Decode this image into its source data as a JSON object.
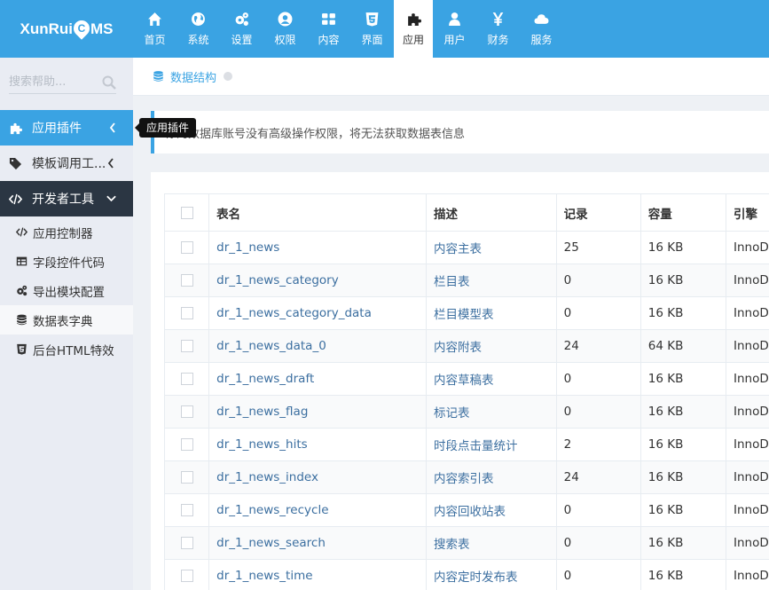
{
  "logo": {
    "pre": "XunRui",
    "drop": "C",
    "post": "MS"
  },
  "nav": [
    {
      "label": "首页",
      "icon": "home-icon"
    },
    {
      "label": "系统",
      "icon": "globe-icon"
    },
    {
      "label": "设置",
      "icon": "gears-icon"
    },
    {
      "label": "权限",
      "icon": "user-circle-icon"
    },
    {
      "label": "内容",
      "icon": "grid-icon"
    },
    {
      "label": "界面",
      "icon": "html5-icon"
    },
    {
      "label": "应用",
      "icon": "puzzle-icon"
    },
    {
      "label": "用户",
      "icon": "user-icon"
    },
    {
      "label": "财务",
      "icon": "yen-icon"
    },
    {
      "label": "服务",
      "icon": "cloud-icon"
    }
  ],
  "sidebar": {
    "search_placeholder": "搜索帮助...",
    "items": [
      {
        "label": "应用插件"
      },
      {
        "label": "模板调用工..."
      },
      {
        "label": "开发者工具"
      }
    ],
    "sub_items": [
      {
        "label": "应用控制器"
      },
      {
        "label": "字段控件代码"
      },
      {
        "label": "导出模块配置"
      },
      {
        "label": "数据表字典"
      },
      {
        "label": "后台HTML特效"
      }
    ]
  },
  "tooltip": "应用插件",
  "breadcrumb": {
    "label": "数据结构"
  },
  "note": "你的数据库账号没有高级操作权限，将无法获取数据表信息",
  "table": {
    "headers": [
      "表名",
      "描述",
      "记录",
      "容量",
      "引擎"
    ],
    "rows": [
      {
        "name": "dr_1_news",
        "desc": "内容主表",
        "records": "25",
        "size": "16 KB",
        "engine": "InnoDB"
      },
      {
        "name": "dr_1_news_category",
        "desc": "栏目表",
        "records": "0",
        "size": "16 KB",
        "engine": "InnoDB"
      },
      {
        "name": "dr_1_news_category_data",
        "desc": "栏目模型表",
        "records": "0",
        "size": "16 KB",
        "engine": "InnoDB"
      },
      {
        "name": "dr_1_news_data_0",
        "desc": "内容附表",
        "records": "24",
        "size": "64 KB",
        "engine": "InnoDB"
      },
      {
        "name": "dr_1_news_draft",
        "desc": "内容草稿表",
        "records": "0",
        "size": "16 KB",
        "engine": "InnoDB"
      },
      {
        "name": "dr_1_news_flag",
        "desc": "标记表",
        "records": "0",
        "size": "16 KB",
        "engine": "InnoDB"
      },
      {
        "name": "dr_1_news_hits",
        "desc": "时段点击量统计",
        "records": "2",
        "size": "16 KB",
        "engine": "InnoDB"
      },
      {
        "name": "dr_1_news_index",
        "desc": "内容索引表",
        "records": "24",
        "size": "16 KB",
        "engine": "InnoDB"
      },
      {
        "name": "dr_1_news_recycle",
        "desc": "内容回收站表",
        "records": "0",
        "size": "16 KB",
        "engine": "InnoDB"
      },
      {
        "name": "dr_1_news_search",
        "desc": "搜索表",
        "records": "0",
        "size": "16 KB",
        "engine": "InnoDB"
      },
      {
        "name": "dr_1_news_time",
        "desc": "内容定时发布表",
        "records": "0",
        "size": "16 KB",
        "engine": "InnoDB"
      }
    ]
  },
  "colors": {
    "accent": "#3aa3e3",
    "dark": "#2b3643",
    "link": "#3c6fa0"
  }
}
